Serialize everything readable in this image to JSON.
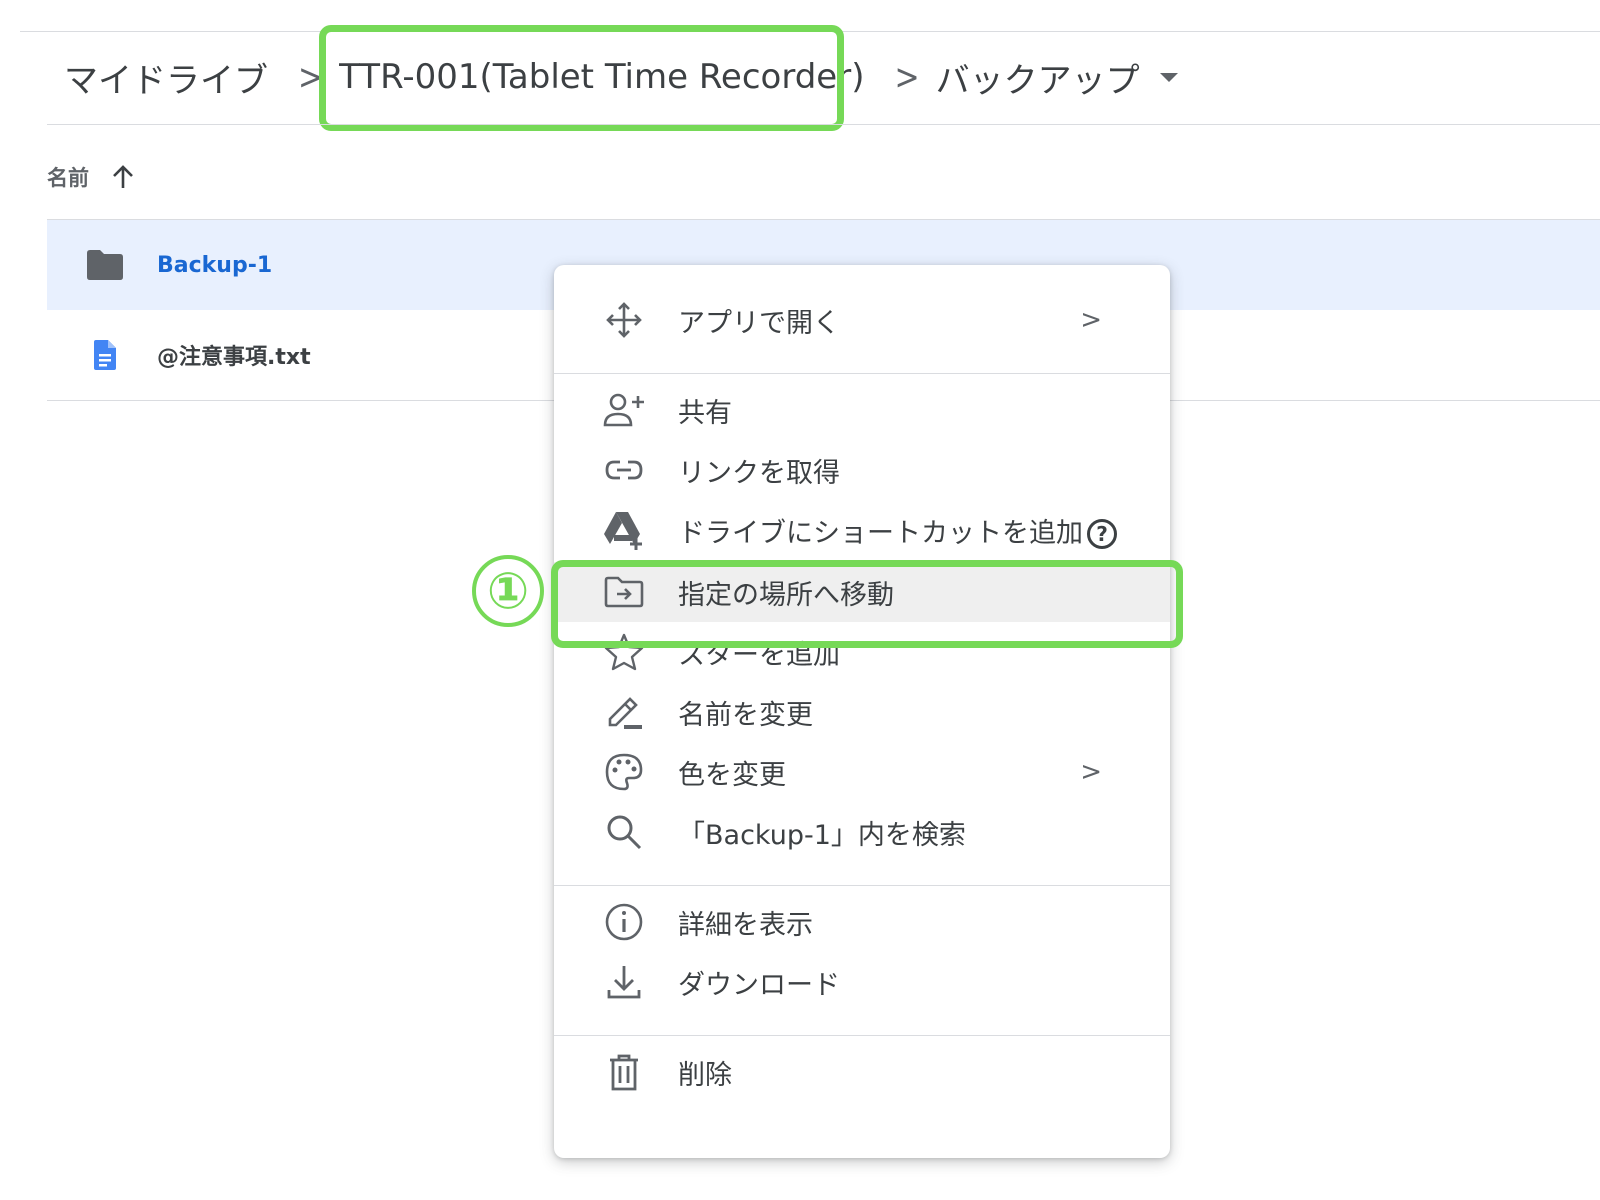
{
  "breadcrumb": {
    "root": "マイドライブ",
    "parent": "TTR-001(Tablet Time Recorder)",
    "current": "バックアップ",
    "separator": ">"
  },
  "list_header": {
    "name_label": "名前",
    "sort_direction": "ascending"
  },
  "files": [
    {
      "name": "Backup-1",
      "type": "folder",
      "icon": "folder-icon",
      "selected": true
    },
    {
      "name": "@注意事項.txt",
      "type": "document",
      "icon": "document-icon",
      "selected": false
    }
  ],
  "context_menu": {
    "items": [
      {
        "label": "アプリで開く",
        "icon": "move-arrows-icon",
        "submenu": true
      },
      {
        "label": "共有",
        "icon": "add-person-icon"
      },
      {
        "label": "リンクを取得",
        "icon": "link-icon"
      },
      {
        "label": "ドライブにショートカットを追加",
        "icon": "drive-shortcut-icon",
        "help": "?"
      },
      {
        "label": "指定の場所へ移動",
        "icon": "move-to-folder-icon",
        "active": true
      },
      {
        "label": "スターを追加",
        "icon": "star-icon"
      },
      {
        "label": "名前を変更",
        "icon": "pencil-icon"
      },
      {
        "label": "色を変更",
        "icon": "palette-icon",
        "submenu": true
      },
      {
        "label": "「Backup-1」内を検索",
        "icon": "search-icon"
      },
      {
        "label": "詳細を表示",
        "icon": "info-icon"
      },
      {
        "label": "ダウンロード",
        "icon": "download-icon"
      },
      {
        "label": "削除",
        "icon": "trash-icon"
      }
    ],
    "submenu_arrow": ">"
  },
  "annotation": {
    "step_marker": "①",
    "highlight_color": "#76d957"
  },
  "colors": {
    "selected_row_bg": "#e8f0fe",
    "selected_text": "#1967d2",
    "document_icon": "#4285f4",
    "text": "#3c4043"
  }
}
